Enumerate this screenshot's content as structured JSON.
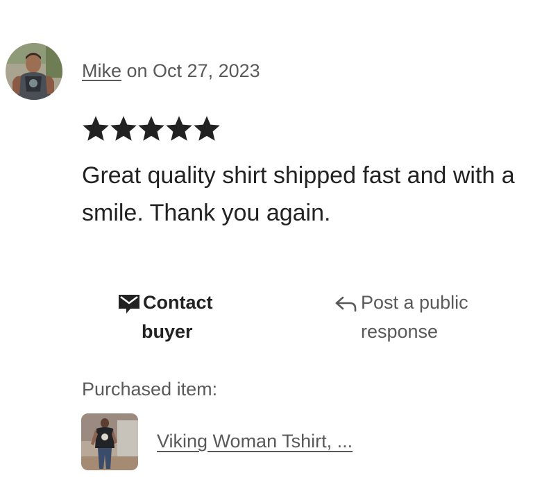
{
  "review": {
    "author": "Mike",
    "date_text": " on Oct 27, 2023",
    "rating": 5,
    "rating_max": 5,
    "star_color": "#222222",
    "text": "Great quality shirt shipped fast and with a smile. Thank you again."
  },
  "actions": {
    "contact_line1": "Contact",
    "contact_line2": "buyer",
    "contact_icon": "envelope-icon",
    "post_line1": "Post a public",
    "post_line2": "response",
    "post_icon": "reply-arrow-icon"
  },
  "purchase": {
    "label": "Purchased item:",
    "item_title": "Viking Woman Tshirt, ..."
  },
  "colors": {
    "text_primary": "#222222",
    "text_secondary": "#595959",
    "background": "#ffffff"
  }
}
